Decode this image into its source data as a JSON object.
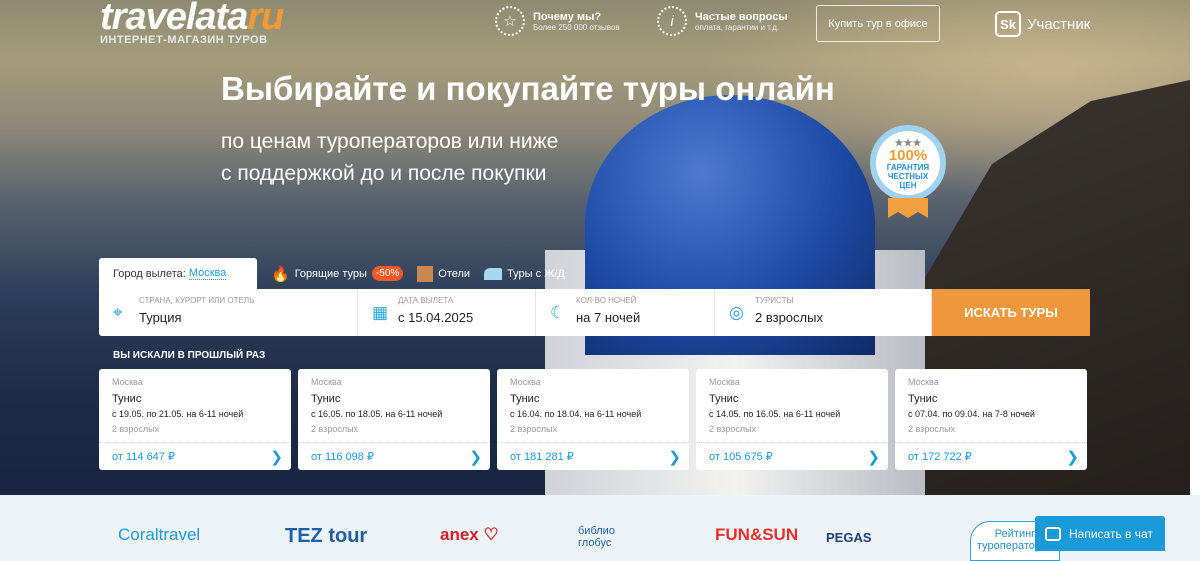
{
  "header": {
    "logo_main": "travelata",
    "logo_ru": "ru",
    "logo_sub": "ИНТЕРНЕТ-МАГАЗИН ТУРОВ",
    "why_title": "Почему мы?",
    "why_sub": "Более 250 000 отзывов",
    "faq_title": "Частые вопросы",
    "faq_sub": "оплата, гарантии и т.д.",
    "office_button": "Купить тур в офисе",
    "sk_icon_text": "Sk",
    "member": "Участник"
  },
  "hero": {
    "title": "Выбирайте и покупайте туры онлайн",
    "line1": "по ценам туроператоров или ниже",
    "line2": "с поддержкой до и после покупки",
    "badge": {
      "stars": "★★★",
      "percent": "100%",
      "l1": "ГАРАНТИЯ",
      "l2": "ЧЕСТНЫХ",
      "l3": "ЦЕН"
    }
  },
  "tabs": {
    "city_label": "Город вылета:",
    "city": "Москва",
    "hot": "Горящие туры",
    "discount": "-50%",
    "hotels": "Отели",
    "rail": "Туры с Ж/Д"
  },
  "search": {
    "dest_label": "Страна, курорт или отель",
    "dest": "Турция",
    "date_label": "Дата вылета",
    "date": "с 15.04.2025",
    "nights_label": "Кол-во ночей",
    "nights": "на 7 ночей",
    "tourists_label": "Туристы",
    "tourists": "2 взрослых",
    "button": "ИСКАТЬ ТУРЫ"
  },
  "previous": {
    "title": "ВЫ ИСКАЛИ В ПРОШЛЫЙ РАЗ",
    "cards": [
      {
        "city": "Москва",
        "dest": "Тунис",
        "dates": "с 19.05. по 21.05. на 6-11 ночей",
        "people": "2 взрослых",
        "price": "от 114 647 ₽"
      },
      {
        "city": "Москва",
        "dest": "Тунис",
        "dates": "с 16.05. по 18.05. на 6-11 ночей",
        "people": "2 взрослых",
        "price": "от 116 098 ₽"
      },
      {
        "city": "Москва",
        "dest": "Тунис",
        "dates": "с 16.04. по 18.04. на 6-11 ночей",
        "people": "2 взрослых",
        "price": "от 181 281 ₽"
      },
      {
        "city": "Москва",
        "dest": "Тунис",
        "dates": "с 14.05. по 16.05. на 6-11 ночей",
        "people": "2 взрослых",
        "price": "от 105 675 ₽"
      },
      {
        "city": "Москва",
        "dest": "Тунис",
        "dates": "с 07.04. по 09.04. на 7-8 ночей",
        "people": "2 взрослых",
        "price": "от 172 722 ₽"
      }
    ]
  },
  "partners": {
    "coral": "Coraltravel",
    "tez": "TEZ tour",
    "anex": "anex ♡",
    "biblio": "библио глобус",
    "fun": "FUN&SUN",
    "pegas": "PEGAS",
    "rating": "Рейтинг туроператоров"
  },
  "chat": {
    "label": "Написать в чат"
  }
}
